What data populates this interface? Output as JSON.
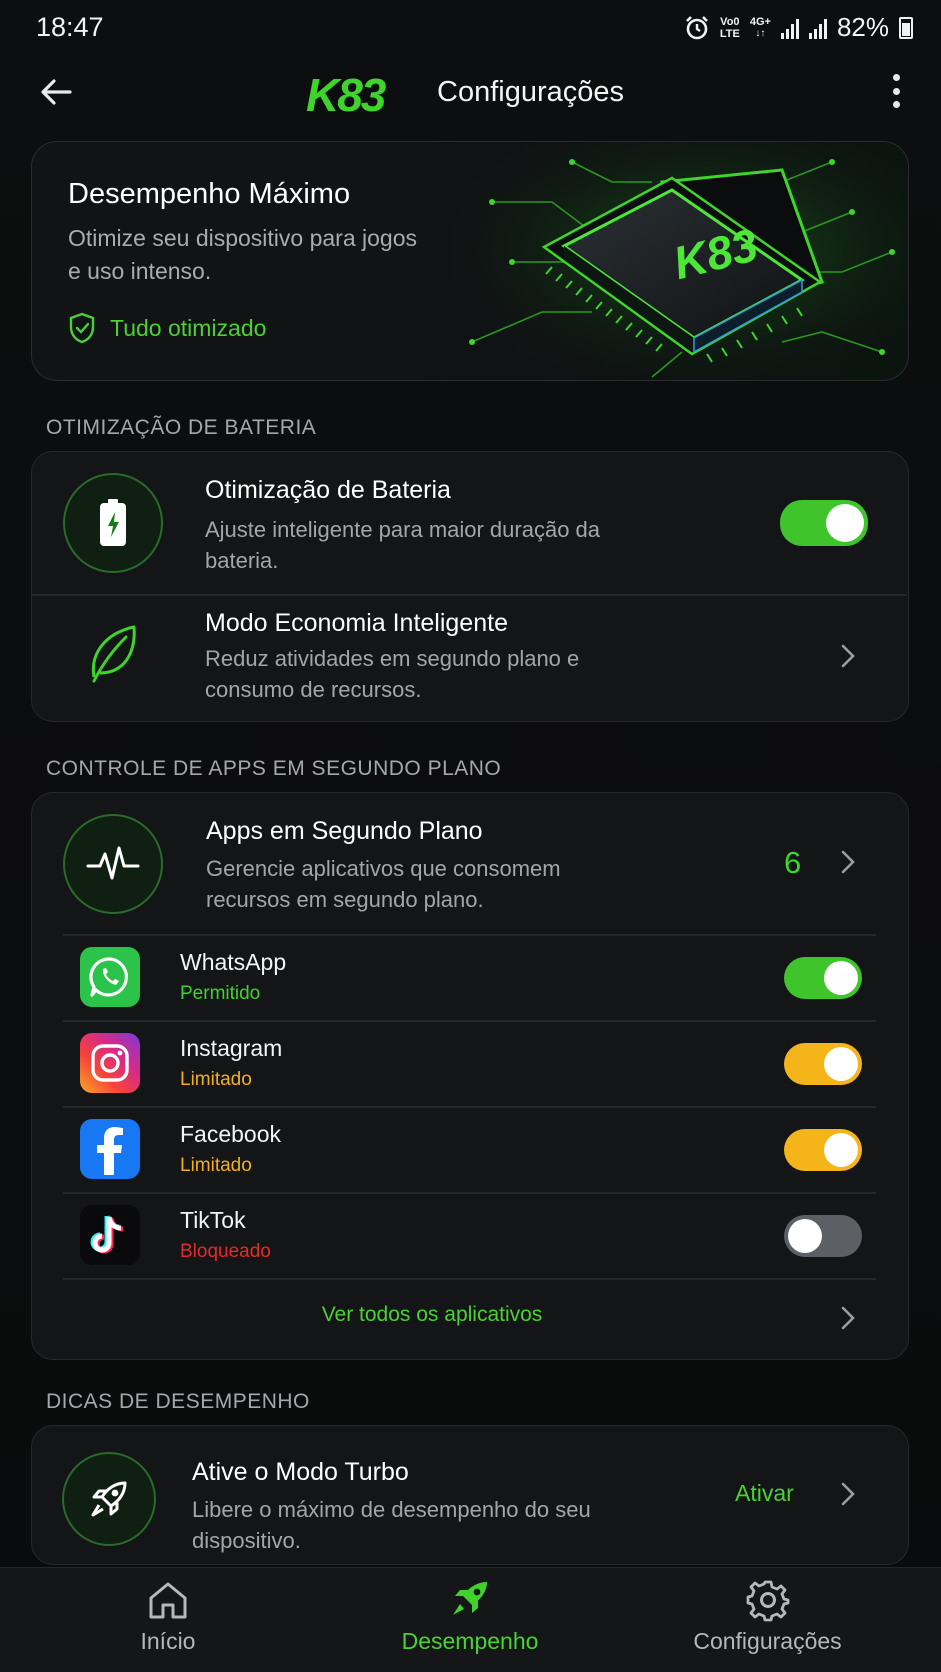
{
  "status_bar": {
    "time": "18:47",
    "network_top": "Vo0",
    "network_bottom": "LTE",
    "network2_top": "4G+",
    "battery": "82%"
  },
  "app_bar": {
    "brand": "K83",
    "title": "Configurações"
  },
  "hero": {
    "title": "Desempenho Máximo",
    "subtitle": "Otimize seu dispositivo para jogos e uso intenso.",
    "status": "Tudo otimizado",
    "chip_label": "K83"
  },
  "battery_section": {
    "label": "OTIMIZAÇÃO DE BATERIA",
    "rows": [
      {
        "title": "Otimização de Bateria",
        "subtitle": "Ajuste inteligente para maior duração da bateria.",
        "toggle_on": true
      },
      {
        "title": "Modo Economia Inteligente",
        "subtitle": "Reduz atividades em segundo plano e consumo de recursos."
      }
    ]
  },
  "background_section": {
    "label": "CONTROLE DE APPS EM SEGUNDO PLANO",
    "header": {
      "title": "Apps em Segundo Plano",
      "subtitle": "Gerencie aplicativos que consomem recursos em segundo plano.",
      "count": "6"
    },
    "apps": [
      {
        "name": "WhatsApp",
        "status": "Permitido",
        "status_color": "#3fd42c",
        "toggle_color": "#3fc42c",
        "toggle_on": true
      },
      {
        "name": "Instagram",
        "status": "Limitado",
        "status_color": "#f2b01e",
        "toggle_color": "#f4b41a",
        "toggle_on": true
      },
      {
        "name": "Facebook",
        "status": "Limitado",
        "status_color": "#f2b01e",
        "toggle_color": "#f4b41a",
        "toggle_on": true
      },
      {
        "name": "TikTok",
        "status": "Bloqueado",
        "status_color": "#e52b2b",
        "toggle_color": "#5c5f63",
        "toggle_on": false
      }
    ],
    "see_all": "Ver todos os aplicativos"
  },
  "tips_section": {
    "label": "DICAS DE DESEMPENHO",
    "tip": {
      "title": "Ative o Modo Turbo",
      "subtitle": "Libere o máximo de desempenho do seu dispositivo.",
      "action": "Ativar"
    }
  },
  "bottom_nav": {
    "items": [
      {
        "label": "Início",
        "icon": "home-icon",
        "active": false
      },
      {
        "label": "Desempenho",
        "icon": "rocket-icon",
        "active": true
      },
      {
        "label": "Configurações",
        "icon": "gear-icon",
        "active": false
      }
    ]
  },
  "colors": {
    "accent": "#3fd42c",
    "background": "#0b0c0d",
    "card": "#131517",
    "warning": "#f4b41a",
    "danger": "#e52b2b"
  }
}
